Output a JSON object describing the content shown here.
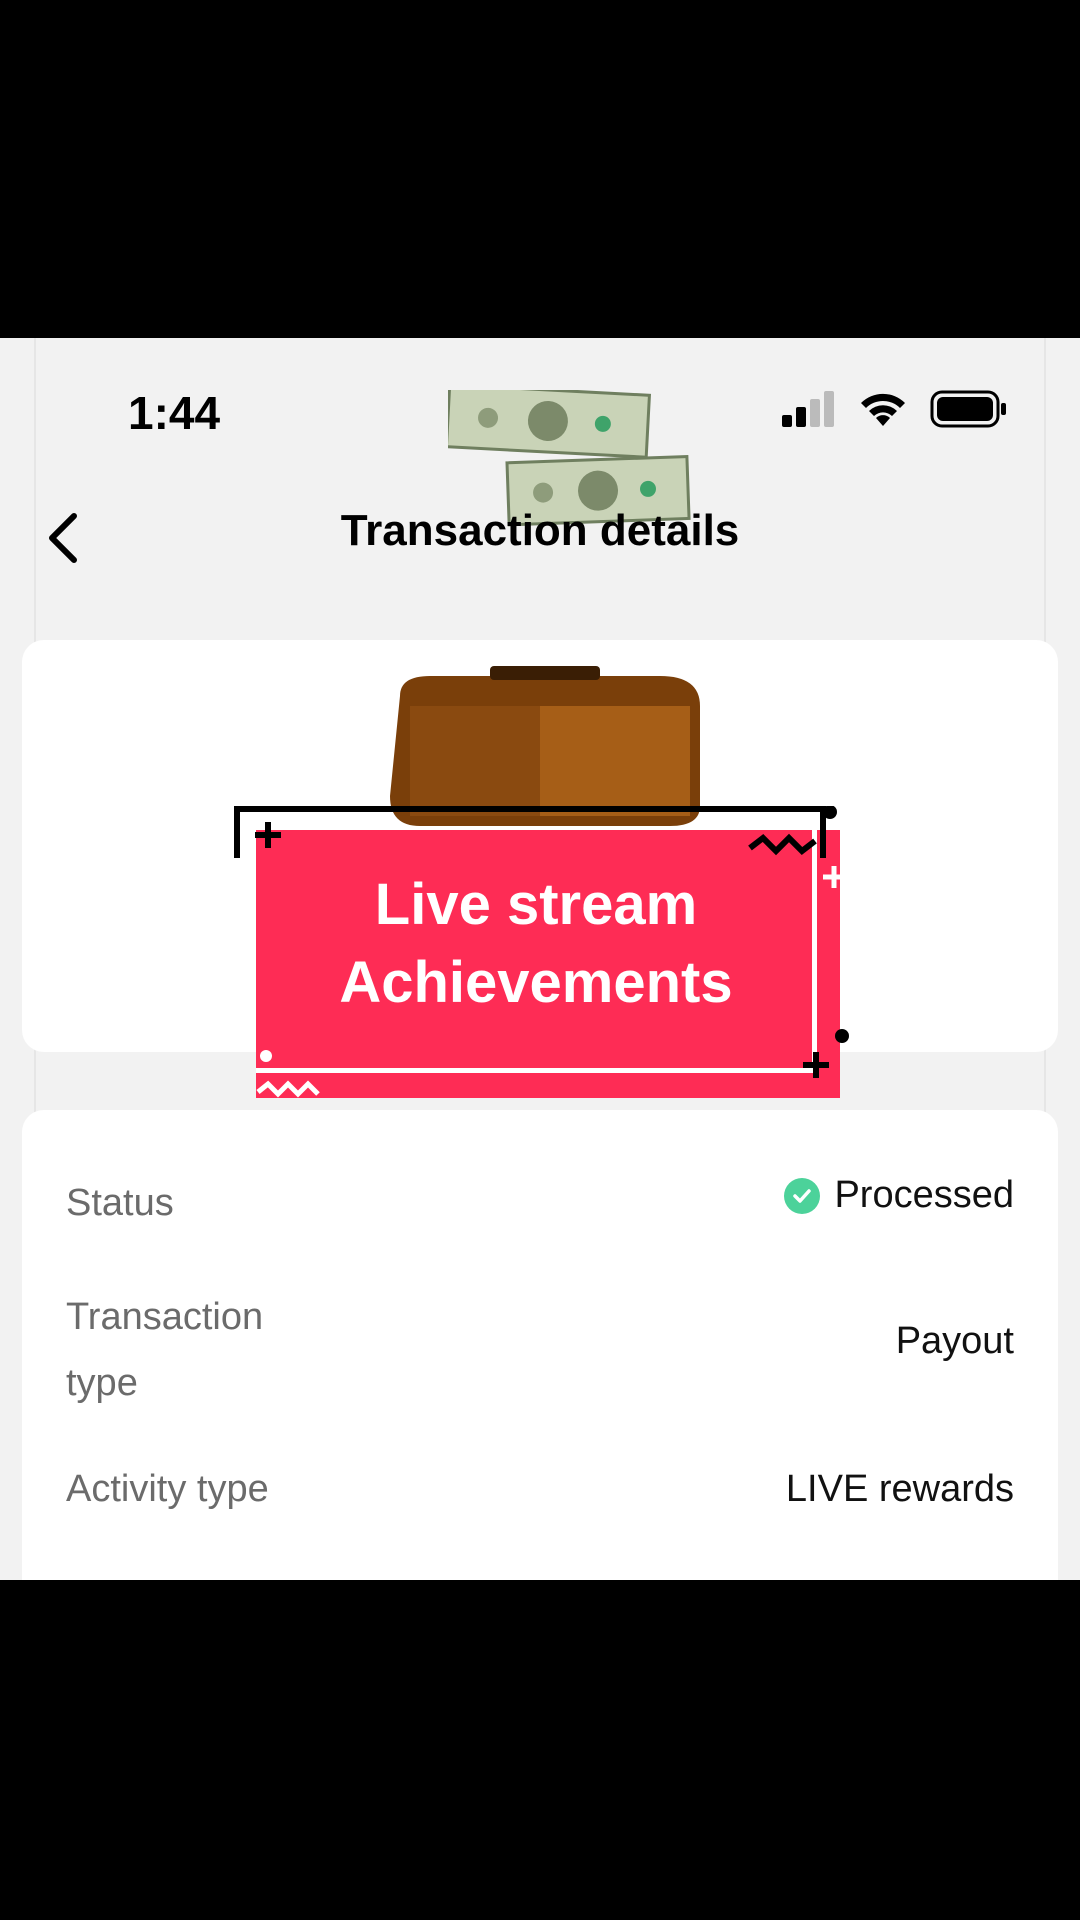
{
  "status_bar": {
    "time": "1:44"
  },
  "header": {
    "title": "Transaction details"
  },
  "sticker": {
    "line1": "Live stream",
    "line2": "Achievements"
  },
  "details": {
    "status_label": "Status",
    "status_value": "Processed",
    "type_label_1": "Transaction",
    "type_label_2": "type",
    "type_value": "Payout",
    "activity_label": "Activity type",
    "activity_value": "LIVE rewards"
  },
  "colors": {
    "accent": "#fe2c55",
    "success": "#4cd29a",
    "background": "#f2f2f2"
  }
}
